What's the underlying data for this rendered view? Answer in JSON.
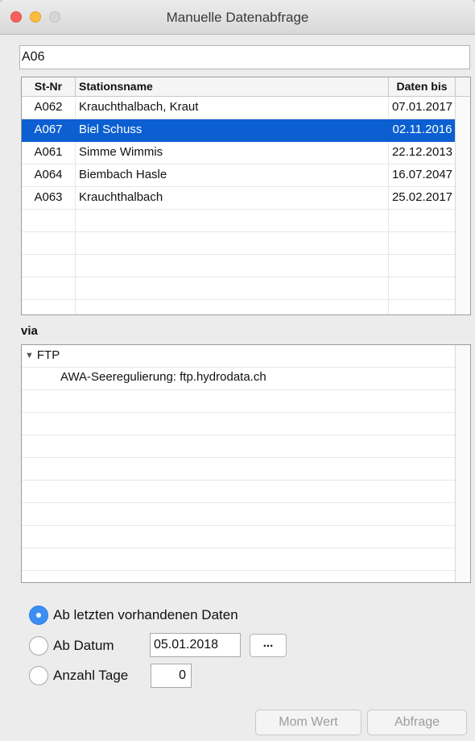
{
  "window": {
    "title": "Manuelle Datenabfrage"
  },
  "search": {
    "value": "A06"
  },
  "table": {
    "columns": {
      "nr": "St-Nr",
      "name": "Stationsname",
      "date": "Daten bis"
    },
    "rows": [
      {
        "nr": "A062",
        "name": "Krauchthalbach, Kraut",
        "date": "07.01.2017"
      },
      {
        "nr": "A067",
        "name": "Biel Schuss",
        "date": "02.11.2016",
        "selected": true
      },
      {
        "nr": "A061",
        "name": "Simme Wimmis",
        "date": "22.12.2013"
      },
      {
        "nr": "A064",
        "name": "Biembach Hasle",
        "date": "16.07.2047"
      },
      {
        "nr": "A063",
        "name": "Krauchthalbach",
        "date": "25.02.2017"
      }
    ],
    "empty_rows": 5
  },
  "via": {
    "label": "via",
    "node": "FTP",
    "child": "AWA-Seeregulierung: ftp.hydrodata.ch",
    "empty_rows": 8
  },
  "options": {
    "ab_letzten": "Ab letzten vorhandenen Daten",
    "ab_datum": "Ab Datum",
    "anzahl_tage": "Anzahl Tage",
    "selected": "ab_letzten",
    "date_value": "05.01.2018",
    "days_value": "0",
    "dots_label": "..."
  },
  "buttons": {
    "mom_wert": "Mom Wert",
    "abfrage": "Abfrage"
  },
  "colors": {
    "selection": "#0b5fd1",
    "radio_checked": "#3d8ef4"
  }
}
